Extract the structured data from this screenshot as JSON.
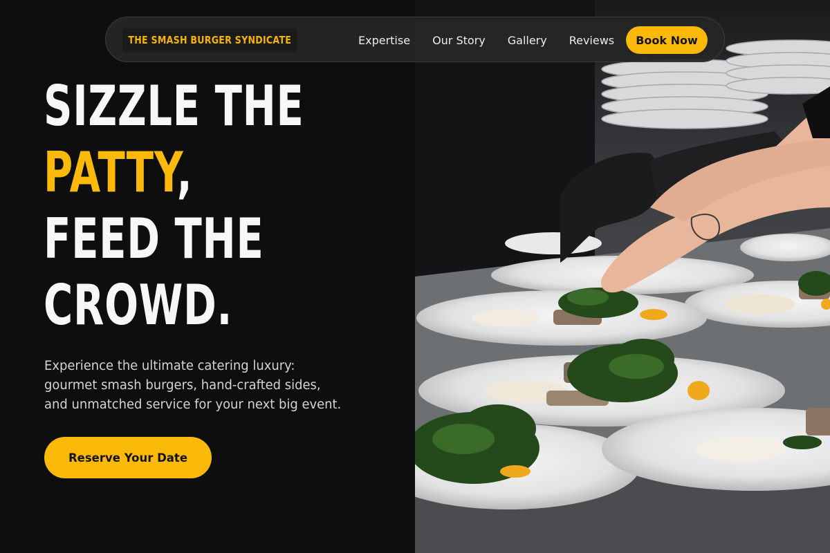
{
  "brand": {
    "logo_text": "THE SMASH BURGER SYNDICATE"
  },
  "nav": {
    "links": [
      "Expertise",
      "Our Story",
      "Gallery",
      "Reviews"
    ],
    "cta_label": "Book Now"
  },
  "hero": {
    "headline": {
      "line1": "SIZZLE THE",
      "line2_accent": "PATTY",
      "line2_rest": ",",
      "line3": "FEED THE",
      "line4": "CROWD."
    },
    "subtitle_lines": [
      "Experience the ultimate catering luxury:",
      "gourmet smash burgers, hand-crafted sides,",
      "and unmatched service for your next big event."
    ],
    "cta_label": "Reserve Your Date"
  },
  "colors": {
    "accent": "#fbb90a",
    "background": "#0e0e0e",
    "text": "#f7f7f7"
  }
}
